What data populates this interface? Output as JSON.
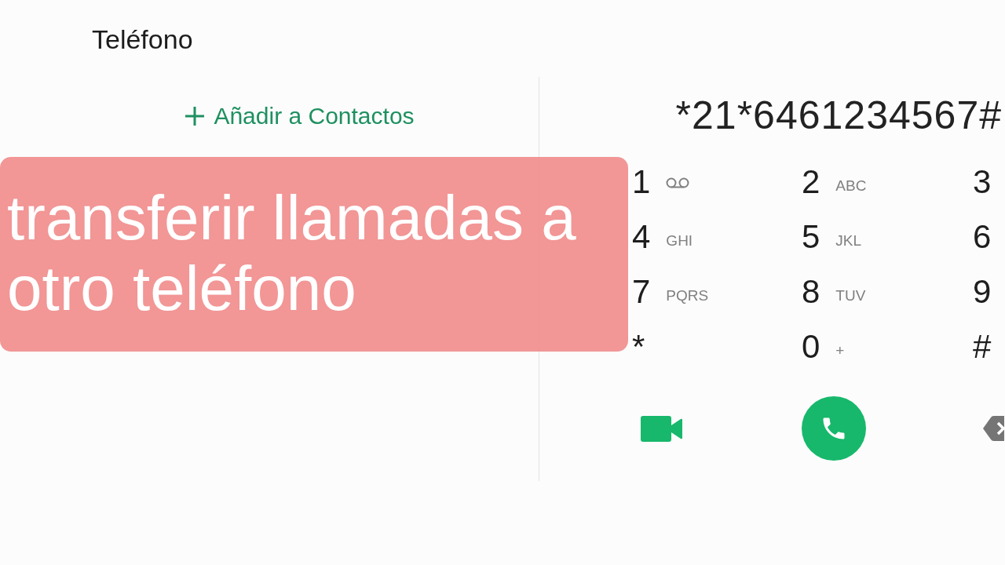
{
  "app": {
    "title": "Teléfono"
  },
  "add_contact": {
    "label": "Añadir a Contactos"
  },
  "caption_overlay": {
    "text": "transferir llamadas a otro teléfono"
  },
  "dialer": {
    "number": "*21*6461234567#",
    "keys": [
      {
        "digit": "1",
        "kind": "voicemail"
      },
      {
        "digit": "2",
        "letters": "ABC",
        "kind": "letters"
      },
      {
        "digit": "3",
        "kind": "plain"
      },
      {
        "digit": "4",
        "letters": "GHI",
        "kind": "letters"
      },
      {
        "digit": "5",
        "letters": "JKL",
        "kind": "letters"
      },
      {
        "digit": "6",
        "kind": "plain"
      },
      {
        "digit": "7",
        "letters": "PQRS",
        "kind": "letters"
      },
      {
        "digit": "8",
        "letters": "TUV",
        "kind": "letters"
      },
      {
        "digit": "9",
        "kind": "plain"
      },
      {
        "digit": "*",
        "kind": "plain"
      },
      {
        "digit": "0",
        "letters": "+",
        "kind": "letters"
      },
      {
        "digit": "#",
        "kind": "plain"
      }
    ],
    "actions": [
      {
        "kind": "video"
      },
      {
        "kind": "call"
      },
      {
        "kind": "backspace"
      }
    ]
  }
}
